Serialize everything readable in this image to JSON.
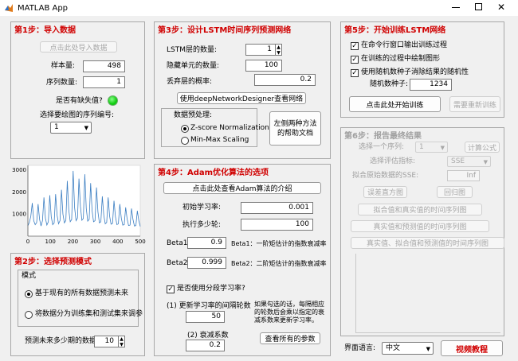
{
  "window": {
    "title": "MATLAB App"
  },
  "p1": {
    "title": "第1步：导入数据",
    "import_btn": "点击此处导入数据",
    "sample_label": "样本量:",
    "sample_val": "498",
    "seq_label": "序列数量:",
    "seq_val": "1",
    "missing_label": "是否有缺失值?",
    "select_label": "选择要绘图的序列编号:",
    "select_val": "1"
  },
  "chart_data": {
    "type": "line",
    "xticks": [
      "0",
      "100",
      "200",
      "300",
      "400",
      "500"
    ],
    "yticks": [
      "1000",
      "2000",
      "3000"
    ],
    "xlim": [
      0,
      500
    ],
    "ylim": [
      0,
      3200
    ],
    "y": [
      480,
      620,
      900,
      1500,
      700,
      520,
      610,
      1450,
      760,
      460,
      700,
      1750,
      820,
      500,
      650,
      1850,
      880,
      520,
      600,
      1900,
      950,
      560,
      700,
      2100,
      1000,
      600,
      700,
      2500,
      1200,
      650,
      750,
      2950,
      1300,
      700,
      820,
      2600,
      1350,
      720,
      800,
      2800,
      1250,
      680,
      760,
      2400,
      1150,
      650,
      700,
      2200,
      1100,
      600,
      650,
      1800,
      950,
      560,
      620,
      1750,
      900,
      540,
      580,
      1600,
      880,
      520,
      560,
      1450,
      820,
      500,
      520,
      1300,
      780,
      480,
      500,
      1250,
      760,
      460,
      480,
      1150,
      700,
      440
    ]
  },
  "p2": {
    "title": "第2步：选择预测模式",
    "mode_title": "模式",
    "opt1": "基于现有的所有数据预测未来",
    "opt2": "将数据分为训练集和测试集来调参",
    "steps_label": "预测未来多少期的数据?",
    "steps_val": "10"
  },
  "p3": {
    "title": "第3步：设计LSTM时间序列预测网络",
    "layers_label": "LSTM层的数量:",
    "layers_val": "1",
    "units_label": "隐藏单元的数量:",
    "units_val": "100",
    "drop_label": "丢弃层的概率:",
    "drop_val": "0.2",
    "designer_btn": "使用deepNetworkDesigner查看网络",
    "pre_title": "数据预处理:",
    "pre_opt1": "Z-score Normalization",
    "pre_opt2": "Min-Max Scaling",
    "help_btn": "左侧两种方法的帮助文档"
  },
  "p4": {
    "title": "第4步：Adam优化算法的选项",
    "intro_btn": "点击此处查看Adam算法的介绍",
    "lr_label": "初始学习率:",
    "lr_val": "0.001",
    "every_label": "执行多少轮:",
    "every_val": "100",
    "b1_label": "Beta1",
    "b1_val": "0.9",
    "b1_desc": "Beta1：一阶矩估计的指数衰减率",
    "b2_label": "Beta2",
    "b2_val": "0.999",
    "b2_desc": "Beta2：二阶矩估计的指数衰减率",
    "seg_label": "是否使用分段学习率?",
    "int_label": "(1) 更新学习率的间隔轮数",
    "int_val": "50",
    "dec_label": "(2) 衰减系数",
    "dec_val": "0.2",
    "note": "如果勾选的话，每隔相应的轮数后会乘以指定的衰减系数来更新学习率。",
    "params_btn": "查看所有的参数"
  },
  "p5": {
    "title": "第5步：开始训练LSTM网络",
    "c1": "在命令行窗口输出训练过程",
    "c2": "在训练的过程中绘制图形",
    "c3": "使用随机数种子消除结果的随机性",
    "seed_label": "随机数种子:",
    "seed_val": "1234",
    "train_btn": "点击此处开始训练",
    "retrain_btn": "需要重新训练"
  },
  "p6": {
    "title": "第6步：报告最终结果",
    "seq_label": "选择一个序列:",
    "seq_val": "1",
    "formula_btn": "计算公式",
    "metric_label": "选择评估指标:",
    "metric_val": "SSE",
    "sse_label": "拟合原始数据的SSE:",
    "sse_val": "Inf",
    "fit_btn": "误差直方图",
    "back_btn": "回归图",
    "b3": "拟合值和真实值的时间序列图",
    "b4": "真实值和预测值的时间序列图",
    "b5": "真实值、拟合值和预测值的时间序列图"
  },
  "footer": {
    "lang_label": "界面语言:",
    "lang_val": "中文",
    "video_btn": "视频教程"
  },
  "colors": {
    "accent": "#d00000",
    "line": "#3b7ec2",
    "lamp": "#22cc22"
  }
}
